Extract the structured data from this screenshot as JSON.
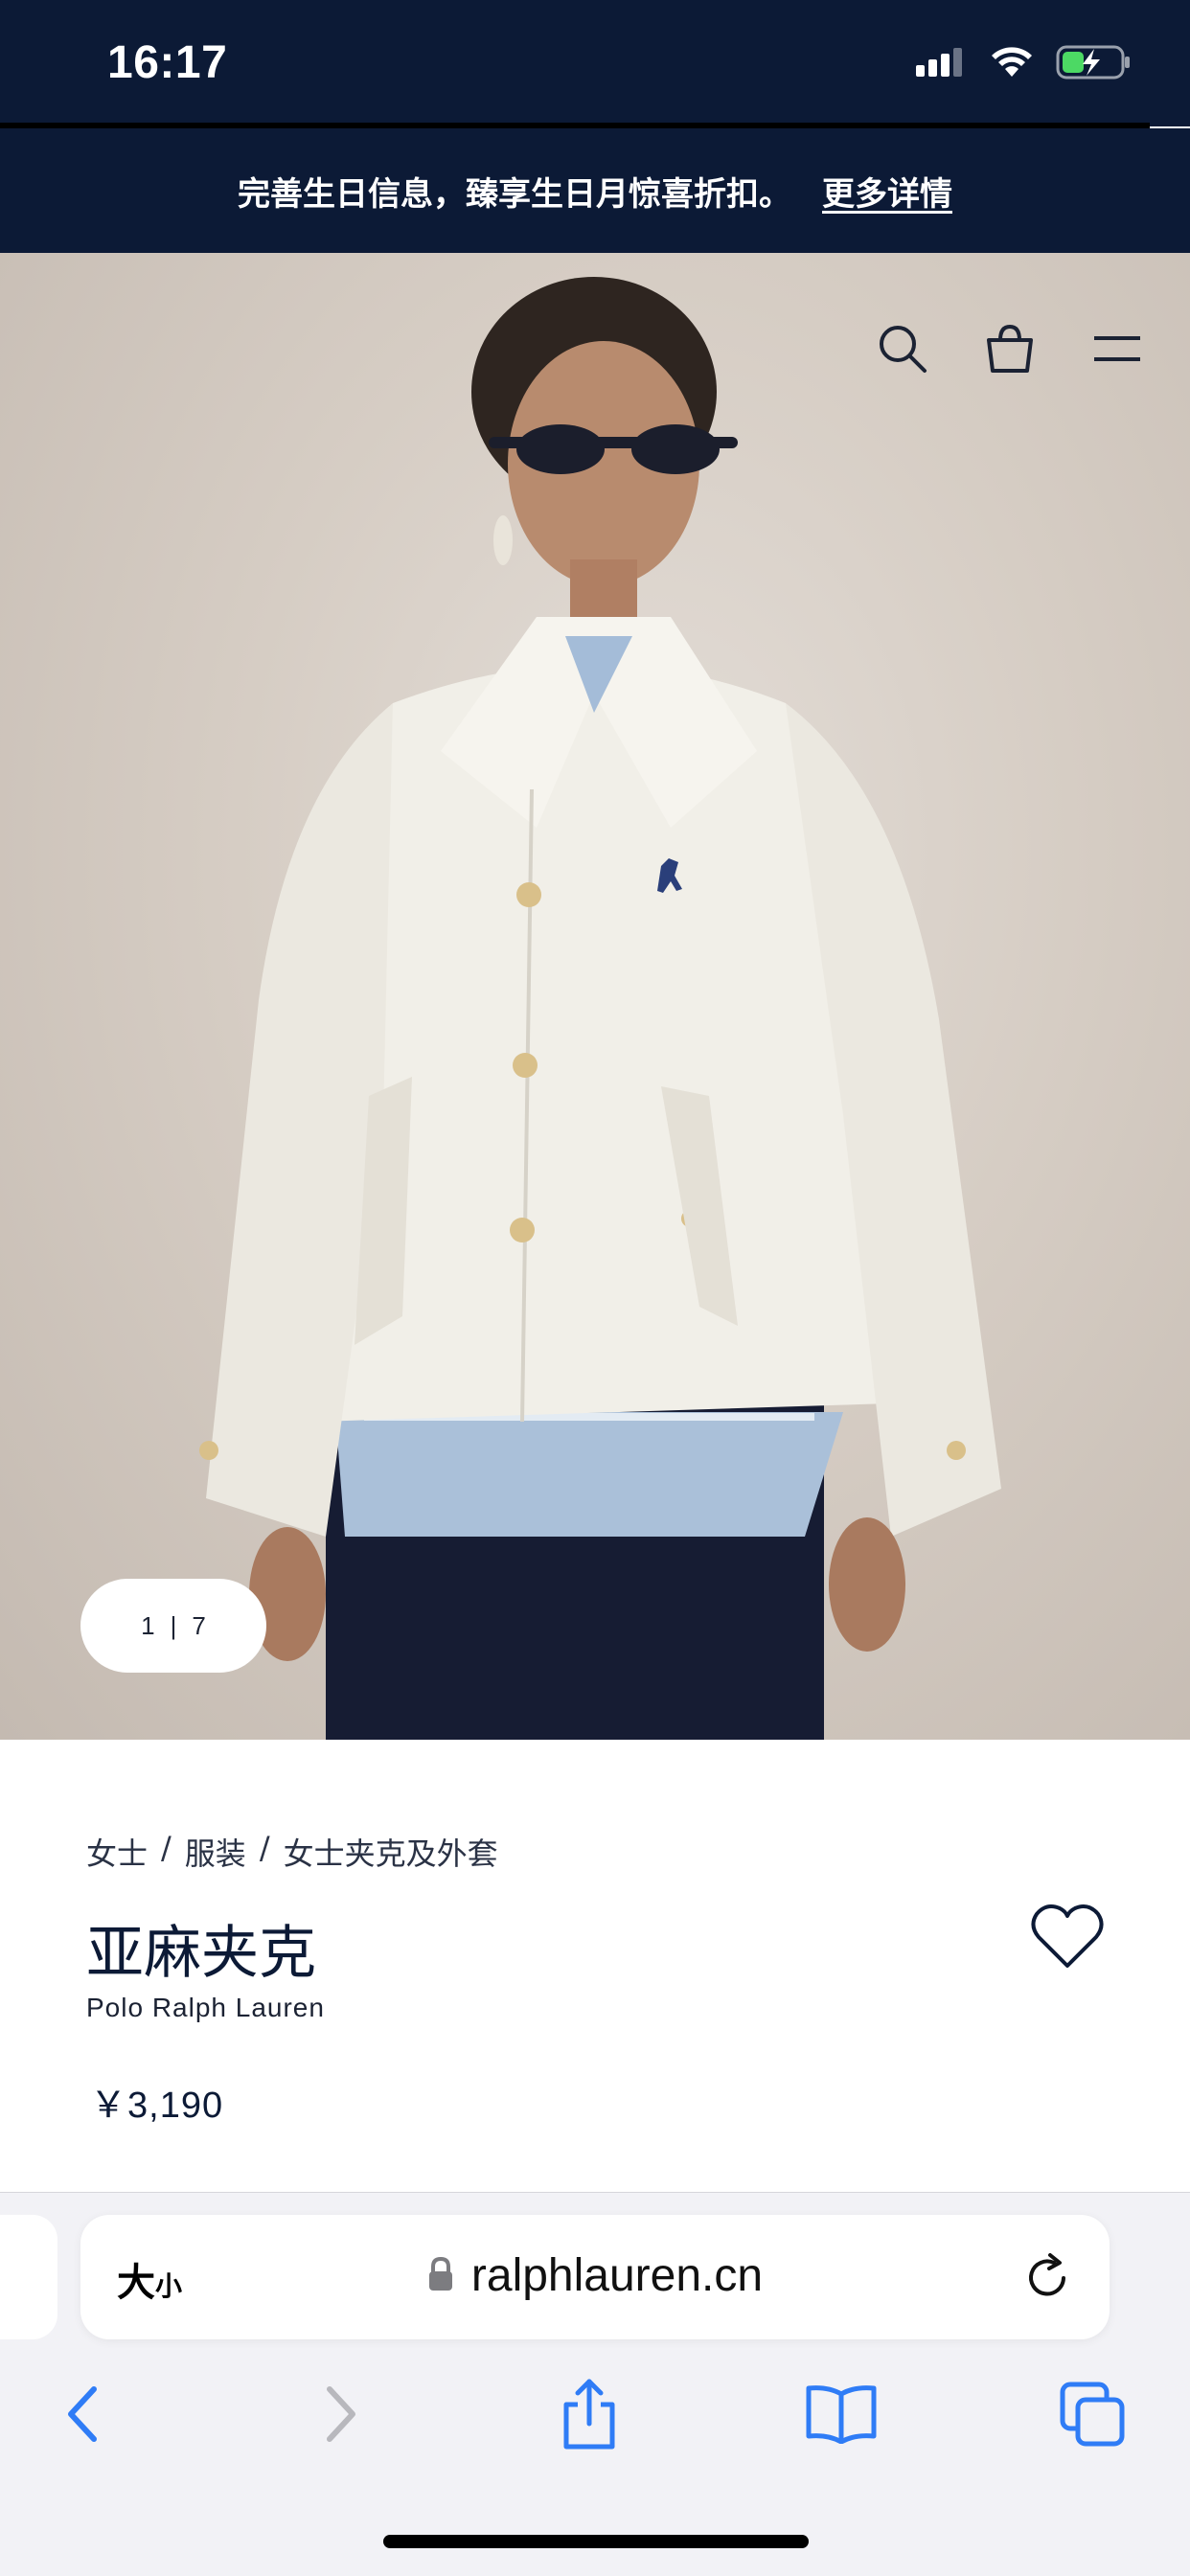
{
  "status_bar": {
    "time": "16:17"
  },
  "promo": {
    "message": "完善生日信息，臻享生日月惊喜折扣。",
    "link": "更多详情"
  },
  "header_icons": [
    "search-icon",
    "shopping-bag-icon",
    "menu-icon"
  ],
  "gallery": {
    "current": "1",
    "separator": "|",
    "total": "7"
  },
  "breadcrumb": [
    "女士",
    "/",
    "服装",
    "/",
    "女士夹克及外套"
  ],
  "product": {
    "title": "亚麻夹克",
    "brand": "Polo Ralph Lauren",
    "price": "￥3,190"
  },
  "browser": {
    "text_size_big": "大",
    "text_size_small": "小",
    "url": "ralphlauren.cn"
  },
  "toolbar": [
    "back-icon",
    "forward-icon",
    "share-icon",
    "bookmarks-icon",
    "tabs-icon"
  ],
  "colors": {
    "navy": "#0c1a36",
    "safari_blue": "#2f7cf6"
  }
}
